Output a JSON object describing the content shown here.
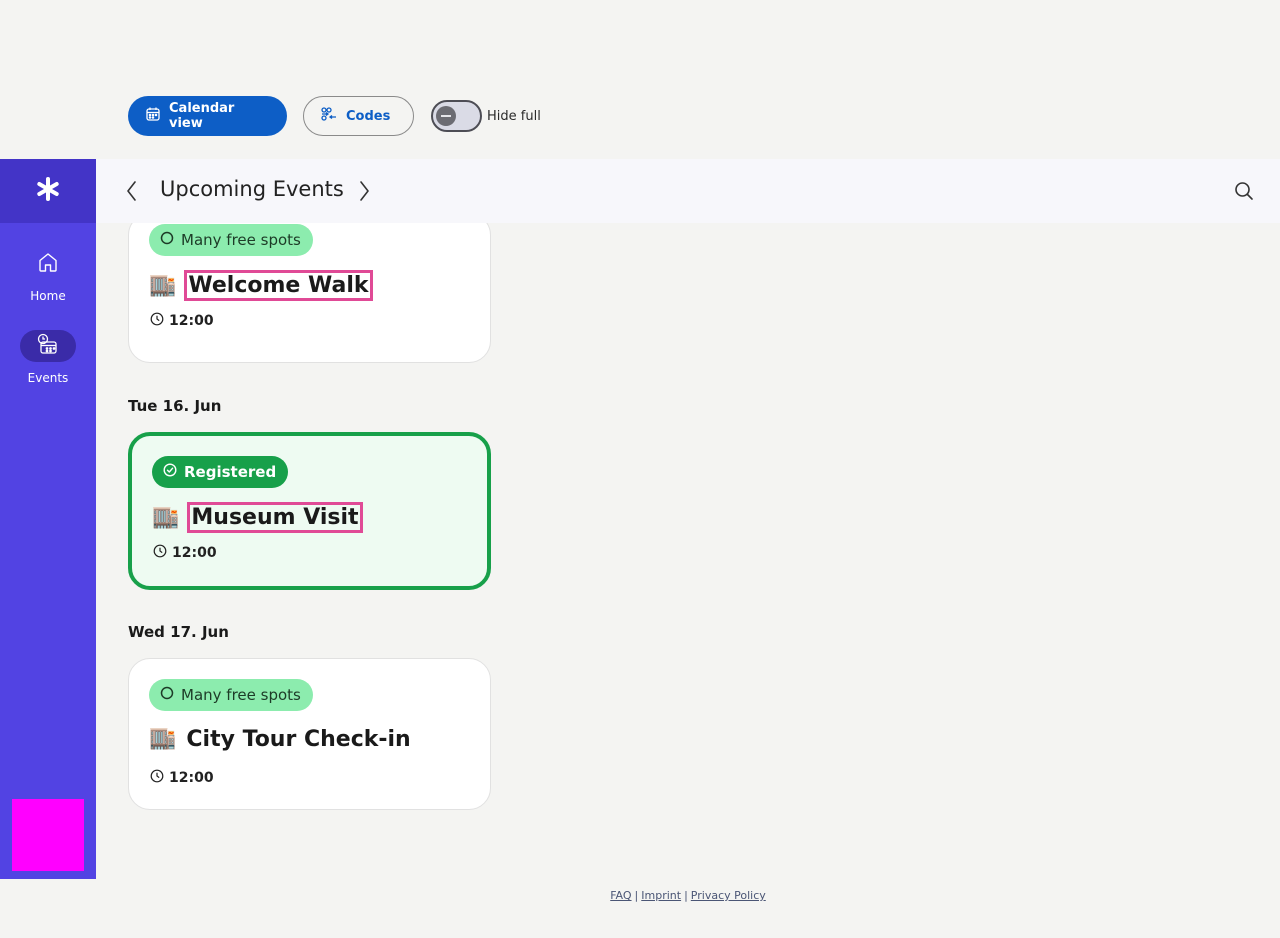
{
  "toolbar": {
    "calendar_view_label": "Calendar view",
    "codes_label": "Codes",
    "hide_full_label": "Hide full",
    "hide_full_enabled": false
  },
  "sidebar": {
    "logo_icon": "asterisk-icon",
    "items": [
      {
        "label": "Home",
        "icon": "home-icon",
        "active": false
      },
      {
        "label": "Events",
        "icon": "events-icon",
        "active": true
      }
    ]
  },
  "header": {
    "title": "Upcoming Events"
  },
  "events": [
    {
      "badge": "Many free spots",
      "emoji": "🏬",
      "title": "Welcome Walk",
      "time": "12:00",
      "status": "free"
    },
    {
      "day": "Tue 16. Jun",
      "badge": "Registered",
      "emoji": "🏬",
      "title": "Museum Visit",
      "time": "12:00",
      "status": "registered"
    },
    {
      "day": "Wed 17. Jun",
      "badge": "Many free spots",
      "emoji": "🏬",
      "title": "City Tour Check-in",
      "time": "12:00",
      "status": "free"
    }
  ],
  "footer": {
    "faq": "FAQ",
    "imprint": "Imprint",
    "privacy": "Privacy Policy",
    "separator": "|"
  },
  "colors": {
    "primary": "#0d5ec6",
    "sidebar": "#5243e3",
    "registered_green": "#17a04a",
    "free_badge": "#8cecae",
    "highlight_outline": "#e04a96"
  }
}
